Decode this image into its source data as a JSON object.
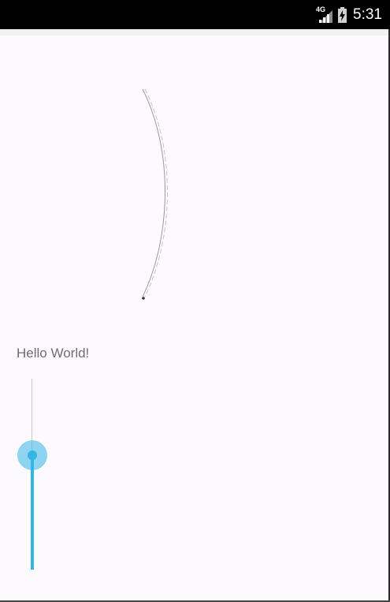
{
  "status_bar": {
    "network_type": "4G",
    "time": "5:31",
    "icons": [
      "signal-icon",
      "battery-charging-icon"
    ]
  },
  "main": {
    "greeting": "Hello World!"
  },
  "seekbar": {
    "orientation": "vertical",
    "progress_fraction": 0.6,
    "accent_color": "#33b5e5"
  },
  "colors": {
    "background": "#fdfafd",
    "status_bar": "#000000",
    "accent": "#33b5e5"
  }
}
